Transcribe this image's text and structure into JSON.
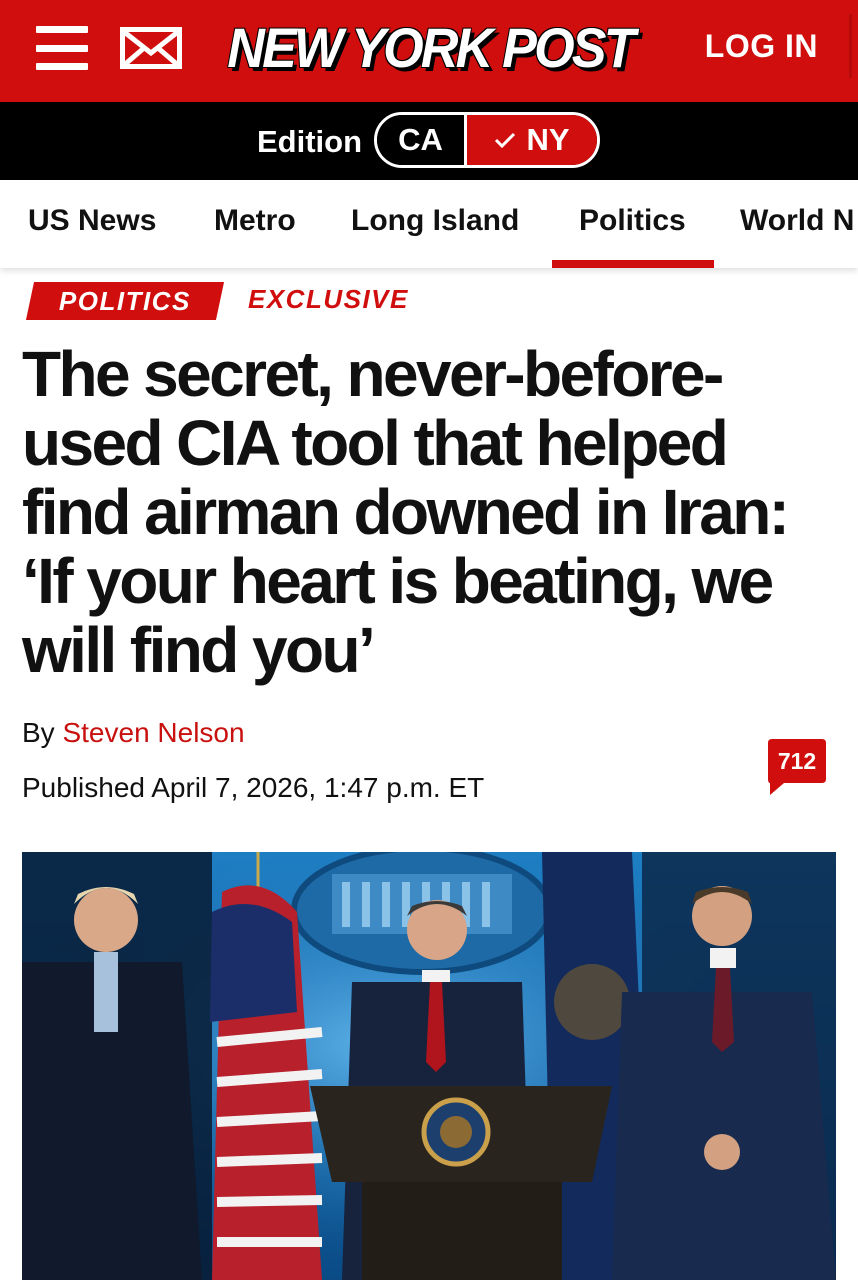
{
  "header": {
    "brand": "NEW YORK POST",
    "login_label": "LOG IN",
    "icons": [
      "menu-icon",
      "mail-icon"
    ],
    "colors": {
      "brand_red": "#d10e0e",
      "edition_bar": "#000000"
    }
  },
  "edition": {
    "label": "Edition",
    "options": [
      "CA",
      "NY"
    ],
    "selected": "NY"
  },
  "nav": {
    "items": [
      "US News",
      "Metro",
      "Long Island",
      "Politics",
      "World N"
    ],
    "active": "Politics"
  },
  "article": {
    "tags": [
      "POLITICS",
      "EXCLUSIVE"
    ],
    "headline_lines": [
      "The secret, never-before-",
      "used CIA tool that helped",
      "find airman downed in Iran:",
      "‘If your heart is beating, we",
      "will find you’"
    ],
    "byline_prefix": "By",
    "author": "Steven Nelson",
    "published": "Published April 7, 2026, 1:47 p.m. ET",
    "comment_count": "712",
    "image_alt": "Men standing at a White House briefing room podium with American flags"
  }
}
